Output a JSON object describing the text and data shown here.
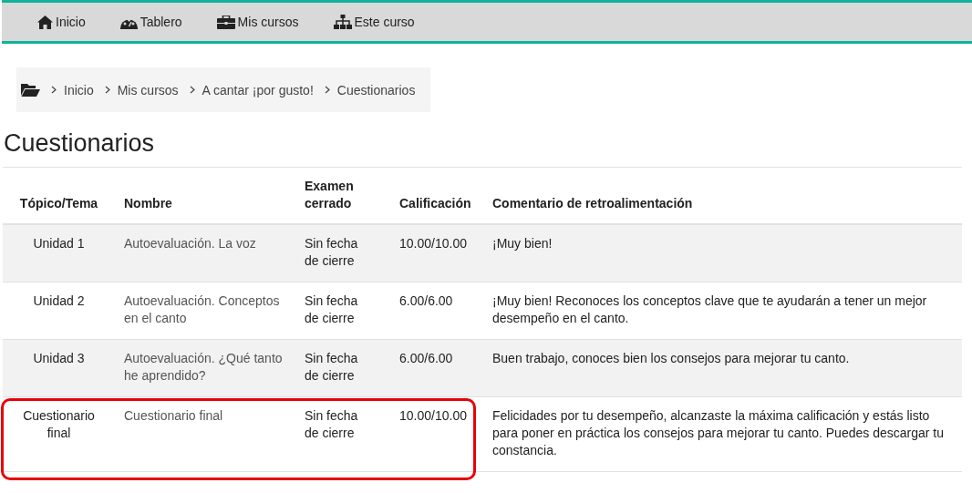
{
  "navbar": {
    "items": [
      {
        "label": "Inicio",
        "kind": "home"
      },
      {
        "label": "Tablero",
        "kind": "dashboard"
      },
      {
        "label": "Mis cursos",
        "kind": "briefcase"
      },
      {
        "label": "Este curso",
        "kind": "sitemap"
      }
    ]
  },
  "breadcrumb": [
    "Inicio",
    "Mis cursos",
    "A cantar ¡por gusto!",
    "Cuestionarios"
  ],
  "page_title": "Cuestionarios",
  "table": {
    "columns": [
      "Tópico/Tema",
      "Nombre",
      "Examen cerrado",
      "Calificación",
      "Comentario de retroalimentación"
    ],
    "rows": [
      {
        "topic": "Unidad 1",
        "name": "Autoevaluación. La voz",
        "closed": "Sin fecha de cierre",
        "grade": "10.00/10.00",
        "feedback": "¡Muy bien!",
        "highlighted": false
      },
      {
        "topic": "Unidad 2",
        "name": "Autoevaluación. Conceptos en el canto",
        "closed": "Sin fecha de cierre",
        "grade": "6.00/6.00",
        "feedback": "¡Muy bien! Reconoces los conceptos clave que te ayudarán a tener un mejor desempeño en el canto.",
        "highlighted": false
      },
      {
        "topic": "Unidad 3",
        "name": "Autoevaluación. ¿Qué tanto he aprendido?",
        "closed": "Sin fecha de cierre",
        "grade": "6.00/6.00",
        "feedback": "Buen trabajo, conoces bien los consejos para mejorar tu canto.",
        "highlighted": false
      },
      {
        "topic": "Cuestionario final",
        "name": "Cuestionario final",
        "closed": "Sin fecha de cierre",
        "grade": "10.00/10.00",
        "feedback": "Felicidades por tu desempeño, alcanzaste la máxima calificación y estás listo para poner en práctica los consejos para mejorar tu canto. Puedes descargar tu constancia.",
        "highlighted": true
      }
    ]
  }
}
